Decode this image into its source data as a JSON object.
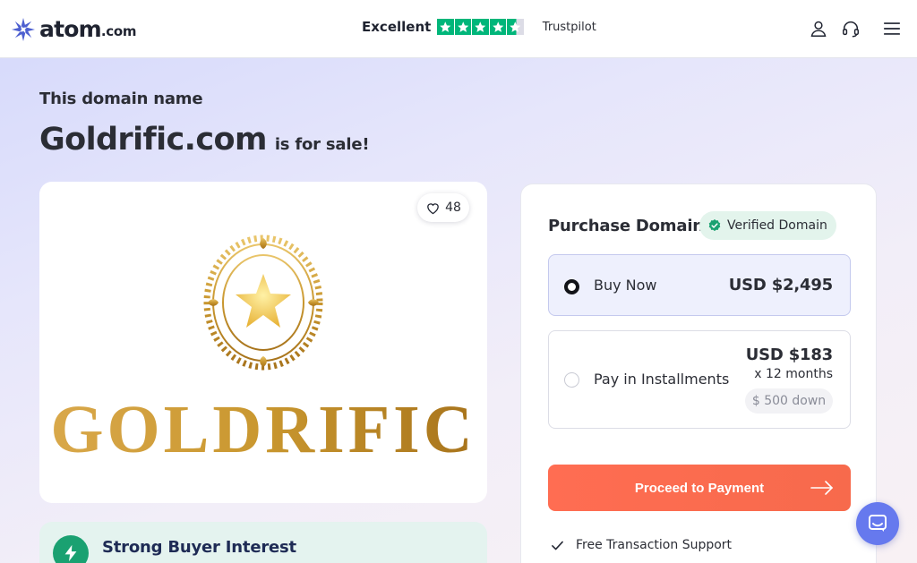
{
  "header": {
    "logo": {
      "name": "atom",
      "tld": ".com"
    },
    "trustpilot": {
      "label": "Excellent",
      "brand": "Trustpilot",
      "stars": 4.5,
      "star_color": "#00b67a"
    },
    "icons": [
      "user-icon",
      "headset-icon",
      "menu-icon"
    ]
  },
  "hero": {
    "eyebrow": "This domain name",
    "domain": "Goldrific.com",
    "suffix": "is for sale!"
  },
  "logo_card": {
    "likes": "48",
    "wordmark": "GOLDRIFIC",
    "brand_gold": "#c9972f"
  },
  "interest": {
    "title": "Strong Buyer Interest"
  },
  "purchase": {
    "title": "Purchase Domain",
    "badge": "Verified Domain",
    "options": [
      {
        "label": "Buy Now",
        "price": "USD $2,495",
        "selected": true
      },
      {
        "label": "Pay in Installments",
        "price": "USD $183",
        "term": "x 12 months",
        "down": "$ 500 down",
        "selected": false
      }
    ],
    "cta": "Proceed to Payment",
    "cta_color": "#f76a4c",
    "feature": "Free Transaction Support"
  },
  "chat": {
    "icon": "chat-icon",
    "color": "#6679ee"
  }
}
